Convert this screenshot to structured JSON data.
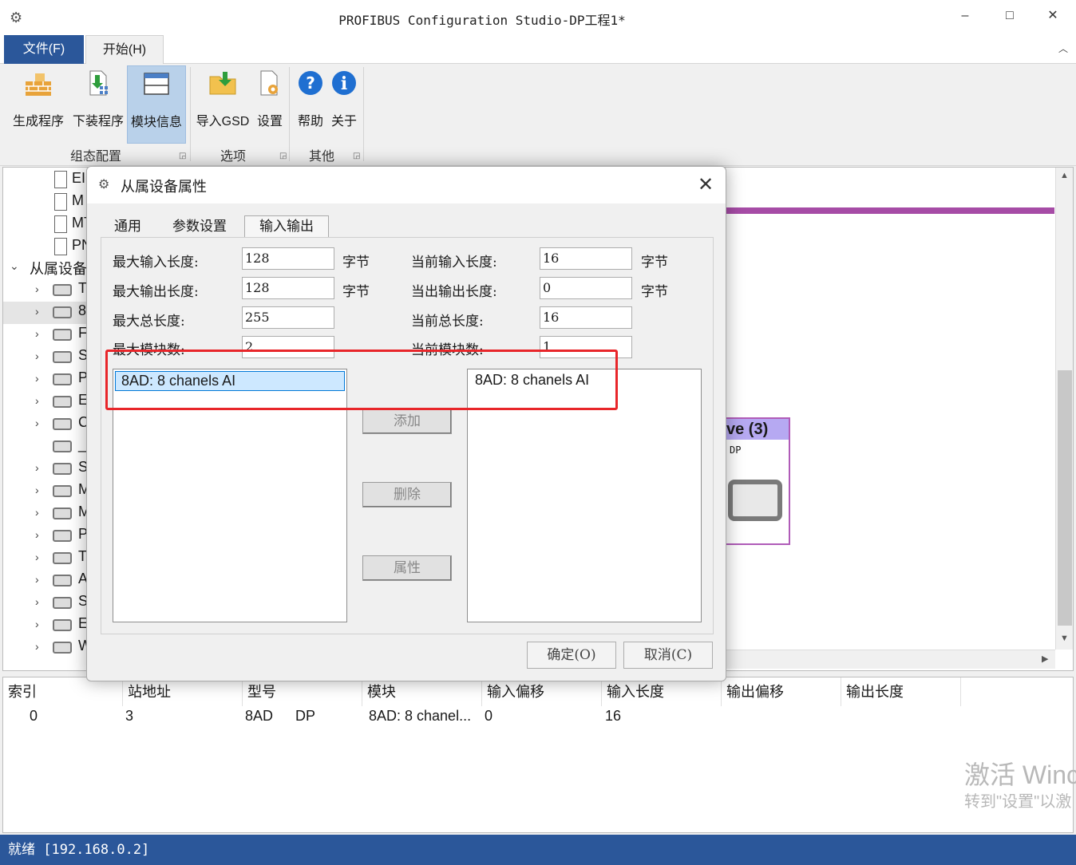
{
  "window": {
    "title": "PROFIBUS Configuration Studio-DP工程1*",
    "minimize": "–",
    "maximize": "□",
    "close": "✕"
  },
  "ribbon": {
    "tabs": {
      "file": "文件(F)",
      "home": "开始(H)"
    },
    "buttons": {
      "generate": "生成程序",
      "download": "下装程序",
      "module_info": "模块信息",
      "import_gsd": "导入GSD",
      "settings": "设置",
      "help": "帮助",
      "about": "关于"
    },
    "groups": {
      "config": "组态配置",
      "options": "选项",
      "other": "其他"
    }
  },
  "tree": {
    "items": [
      {
        "text": "EIF"
      },
      {
        "text": "M"
      },
      {
        "text": "MT"
      },
      {
        "text": "PN"
      }
    ],
    "slave_header": "从属设备",
    "slaves": [
      {
        "text": "T"
      },
      {
        "text": "8"
      },
      {
        "text": "F"
      },
      {
        "text": "S"
      },
      {
        "text": "P"
      },
      {
        "text": "E"
      },
      {
        "text": "C"
      },
      {
        "text": "_"
      },
      {
        "text": "S"
      },
      {
        "text": "M"
      },
      {
        "text": "M"
      },
      {
        "text": "P"
      },
      {
        "text": "T"
      },
      {
        "text": "A"
      },
      {
        "text": "S"
      },
      {
        "text": "E"
      },
      {
        "text": "W"
      }
    ]
  },
  "canvas": {
    "slave_box_title": "ve (3)",
    "slave_box_sub": "DP"
  },
  "dialog": {
    "title": "从属设备属性",
    "tabs": {
      "general": "通用",
      "params": "参数设置",
      "io": "输入输出"
    },
    "fields": {
      "max_in_label": "最大输入长度:",
      "max_in_value": "128",
      "max_in_unit": "字节",
      "max_out_label": "最大输出长度:",
      "max_out_value": "128",
      "max_out_unit": "字节",
      "max_total_label": "最大总长度:",
      "max_total_value": "255",
      "max_modules_label": "最大模块数:",
      "max_modules_value": "2",
      "cur_in_label": "当前输入长度:",
      "cur_in_value": "16",
      "cur_in_unit": "字节",
      "cur_out_label": "当出输出长度:",
      "cur_out_value": "0",
      "cur_out_unit": "字节",
      "cur_total_label": "当前总长度:",
      "cur_total_value": "16",
      "cur_modules_label": "当前模块数:",
      "cur_modules_value": "1"
    },
    "available_modules": [
      "8AD: 8 chanels AI"
    ],
    "configured_modules": [
      "8AD: 8 chanels AI"
    ],
    "buttons": {
      "add": "添加",
      "delete": "删除",
      "properties": "属性",
      "ok": "确定(O)",
      "cancel": "取消(C)"
    }
  },
  "grid": {
    "columns": [
      "索引",
      "站地址",
      "型号",
      "模块",
      "输入偏移",
      "输入长度",
      "输出偏移",
      "输出长度"
    ],
    "rows": [
      {
        "index": "0",
        "station": "3",
        "model": "8AD",
        "type": "DP",
        "module": "8AD: 8 chanel...",
        "in_offset": "0",
        "in_length": "16"
      }
    ]
  },
  "watermark": {
    "line1": "激活 Winc",
    "line2": "转到\"设置\"以激"
  },
  "status": {
    "text": "就绪 [192.168.0.2]"
  },
  "colors": {
    "accent": "#2b579a",
    "highlight": "#e8262a",
    "slave_header": "#b6a9f2"
  }
}
